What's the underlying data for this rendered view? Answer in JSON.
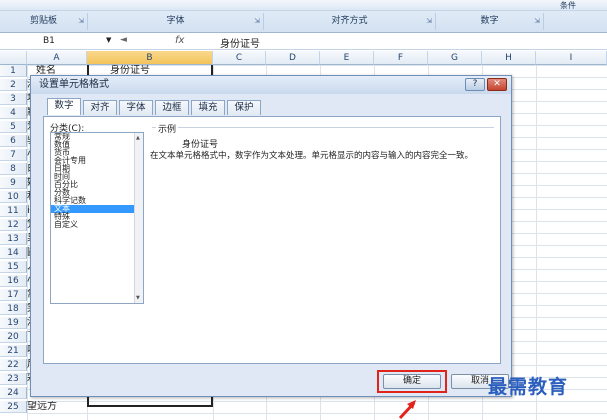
{
  "ribbon": {
    "groups": [
      {
        "label": "剪贴板"
      },
      {
        "label": "字体"
      },
      {
        "label": "对齐方式"
      },
      {
        "label": "数字"
      }
    ],
    "partial_right": "条件"
  },
  "formula_bar": {
    "cell_ref": "B1",
    "fx": "fx",
    "content": "身份证号"
  },
  "columns": [
    "A",
    "B",
    "C",
    "D",
    "E",
    "F",
    "G",
    "H",
    "I"
  ],
  "rows": [
    "1",
    "2",
    "3",
    "4",
    "5",
    "6",
    "7",
    "8",
    "9",
    "10",
    "11",
    "12",
    "13",
    "14",
    "15",
    "16",
    "17",
    "18",
    "19",
    "20",
    "21",
    "22",
    "23",
    "24",
    "25"
  ],
  "cells": {
    "a1": "姓名",
    "b1": "身份证号",
    "col_a_partial": [
      "清",
      "坦",
      "默",
      "爱",
      "骓",
      "小",
      "白",
      "娆",
      "和",
      "i",
      "凭",
      "枭",
      "圆",
      "人",
      "小",
      "常",
      "笑",
      "沐",
      "飞",
      "哗",
      "后",
      "彩"
    ],
    "a24": "望远方"
  },
  "dialog": {
    "title": "设置单元格格式",
    "help": "?",
    "close": "✕",
    "tabs": [
      "数字",
      "对齐",
      "字体",
      "边框",
      "填充",
      "保护"
    ],
    "category_label": "分类(C):",
    "categories": [
      "常规",
      "数值",
      "货币",
      "会计专用",
      "日期",
      "时间",
      "百分比",
      "分数",
      "科学记数",
      "文本",
      "特殊",
      "自定义"
    ],
    "selected_category": "文本",
    "sample_label": "示例",
    "sample_value": "身份证号",
    "description": "在文本单元格格式中，数字作为文本处理。单元格显示的内容与输入的内容完全一致。",
    "ok": "确定",
    "cancel": "取消"
  },
  "watermark": "最需教育",
  "colors": {
    "highlight": "#e2231a",
    "selection": "#3399ff"
  }
}
